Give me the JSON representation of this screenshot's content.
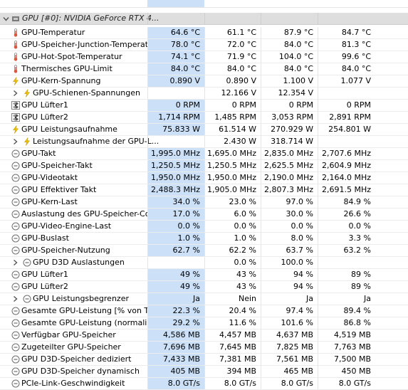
{
  "group": {
    "label": "GPU [#0]: NVIDIA GeForce RTX 4..."
  },
  "colors": {
    "selection": "#cce0f8",
    "thermo": "#d9573c",
    "bolt": "#f2c200",
    "clock_ring": "#6f6f6f"
  },
  "rows": [
    {
      "label": "GPU-Temperatur",
      "icon": "thermometer-icon",
      "indent": 0,
      "expandable": false,
      "values": [
        "64.6 °C",
        "61.1 °C",
        "87.9 °C",
        "84.7 °C"
      ]
    },
    {
      "label": "GPU-Speicher-Junction-Temperatur",
      "icon": "thermometer-icon",
      "indent": 0,
      "expandable": false,
      "values": [
        "78.0 °C",
        "72.0 °C",
        "84.0 °C",
        "81.3 °C"
      ]
    },
    {
      "label": "GPU-Hot-Spot-Temperatur",
      "icon": "thermometer-icon",
      "indent": 0,
      "expandable": false,
      "values": [
        "74.1 °C",
        "71.9 °C",
        "104.0 °C",
        "99.6 °C"
      ]
    },
    {
      "label": "Thermisches GPU-Limit",
      "icon": "thermometer-icon",
      "indent": 0,
      "expandable": false,
      "values": [
        "84.0 °C",
        "84.0 °C",
        "84.0 °C",
        "84.0 °C"
      ]
    },
    {
      "label": "GPU-Kern-Spannung",
      "icon": "lightning-icon",
      "indent": 0,
      "expandable": false,
      "values": [
        "0.890 V",
        "0.890 V",
        "1.100 V",
        "1.077 V"
      ]
    },
    {
      "label": "GPU-Schienen-Spannungen",
      "icon": "lightning-icon",
      "indent": 1,
      "expandable": true,
      "values": [
        "",
        "12.166 V",
        "12.354 V",
        ""
      ]
    },
    {
      "label": "GPU Lüfter1",
      "icon": "fan-icon",
      "indent": 0,
      "expandable": false,
      "values": [
        "0 RPM",
        "0 RPM",
        "0 RPM",
        "0 RPM"
      ]
    },
    {
      "label": "GPU Lüfter2",
      "icon": "fan-icon",
      "indent": 0,
      "expandable": false,
      "values": [
        "1,714 RPM",
        "1,485 RPM",
        "3,053 RPM",
        "2,891 RPM"
      ]
    },
    {
      "label": "GPU Leistungsaufnahme",
      "icon": "lightning-icon",
      "indent": 0,
      "expandable": false,
      "values": [
        "75.833 W",
        "61.514 W",
        "270.929 W",
        "254.801 W"
      ]
    },
    {
      "label": "Leistungsaufnahme der GPU-L...",
      "icon": "lightning-icon",
      "indent": 1,
      "expandable": true,
      "values": [
        "",
        "2.430 W",
        "318.714 W",
        ""
      ]
    },
    {
      "label": "GPU-Takt",
      "icon": "clock-icon",
      "indent": 0,
      "expandable": false,
      "values": [
        "1,995.0 MHz",
        "1,695.0 MHz",
        "2,835.0 MHz",
        "2,707.6 MHz"
      ]
    },
    {
      "label": "GPU-Speicher-Takt",
      "icon": "clock-icon",
      "indent": 0,
      "expandable": false,
      "values": [
        "1,250.5 MHz",
        "1,250.5 MHz",
        "2,625.5 MHz",
        "2,604.9 MHz"
      ]
    },
    {
      "label": "GPU-Videotakt",
      "icon": "clock-icon",
      "indent": 0,
      "expandable": false,
      "values": [
        "1,950.0 MHz",
        "1,950.0 MHz",
        "2,190.0 MHz",
        "2,164.0 MHz"
      ]
    },
    {
      "label": "GPU Effektiver Takt",
      "icon": "clock-icon",
      "indent": 0,
      "expandable": false,
      "values": [
        "2,488.3 MHz",
        "1,905.0 MHz",
        "2,807.3 MHz",
        "2,691.5 MHz"
      ]
    },
    {
      "label": "GPU-Kern-Last",
      "icon": "clock-icon",
      "indent": 0,
      "expandable": false,
      "values": [
        "34.0 %",
        "23.0 %",
        "97.0 %",
        "84.9 %"
      ]
    },
    {
      "label": "Auslastung des GPU-Speicher-Co...",
      "icon": "clock-icon",
      "indent": 0,
      "expandable": false,
      "values": [
        "17.0 %",
        "6.0 %",
        "30.0 %",
        "26.6 %"
      ]
    },
    {
      "label": "GPU-Video-Engine-Last",
      "icon": "clock-icon",
      "indent": 0,
      "expandable": false,
      "values": [
        "0.0 %",
        "0.0 %",
        "0.0 %",
        "0.0 %"
      ]
    },
    {
      "label": "GPU-Buslast",
      "icon": "clock-icon",
      "indent": 0,
      "expandable": false,
      "values": [
        "1.0 %",
        "1.0 %",
        "8.0 %",
        "3.3 %"
      ]
    },
    {
      "label": "GPU-Speicher-Nutzung",
      "icon": "clock-icon",
      "indent": 0,
      "expandable": false,
      "values": [
        "62.7 %",
        "62.2 %",
        "63.7 %",
        "63.2 %"
      ]
    },
    {
      "label": "GPU D3D Auslastungen",
      "icon": "clock-icon",
      "indent": 1,
      "expandable": true,
      "values": [
        "",
        "0.0 %",
        "100.0 %",
        ""
      ]
    },
    {
      "label": "GPU Lüfter1",
      "icon": "clock-icon",
      "indent": 0,
      "expandable": false,
      "values": [
        "49 %",
        "43 %",
        "94 %",
        "89 %"
      ]
    },
    {
      "label": "GPU Lüfter2",
      "icon": "clock-icon",
      "indent": 0,
      "expandable": false,
      "values": [
        "49 %",
        "43 %",
        "94 %",
        "89 %"
      ]
    },
    {
      "label": "GPU Leistungsbegrenzer",
      "icon": "clock-icon",
      "indent": 1,
      "expandable": true,
      "values": [
        "Ja",
        "Nein",
        "Ja",
        "Ja"
      ]
    },
    {
      "label": "Gesamte GPU-Leistung [% von T...",
      "icon": "clock-icon",
      "indent": 0,
      "expandable": false,
      "values": [
        "22.3 %",
        "20.4 %",
        "97.4 %",
        "89.4 %"
      ]
    },
    {
      "label": "Gesamte GPU-Leistung (normalisi...",
      "icon": "clock-icon",
      "indent": 0,
      "expandable": false,
      "values": [
        "29.2 %",
        "11.6 %",
        "101.6 %",
        "86.8 %"
      ]
    },
    {
      "label": "Verfügbar GPU-Speicher",
      "icon": "clock-icon",
      "indent": 0,
      "expandable": false,
      "values": [
        "4,586 MB",
        "4,457 MB",
        "4,637 MB",
        "4,519 MB"
      ]
    },
    {
      "label": "Zugeteilter GPU-Speicher",
      "icon": "clock-icon",
      "indent": 0,
      "expandable": false,
      "values": [
        "7,696 MB",
        "7,645 MB",
        "7,825 MB",
        "7,763 MB"
      ]
    },
    {
      "label": "GPU D3D-Speicher dediziert",
      "icon": "clock-icon",
      "indent": 0,
      "expandable": false,
      "values": [
        "7,433 MB",
        "7,381 MB",
        "7,561 MB",
        "7,500 MB"
      ]
    },
    {
      "label": "GPU D3D-Speicher dynamisch",
      "icon": "clock-icon",
      "indent": 0,
      "expandable": false,
      "values": [
        "405 MB",
        "394 MB",
        "465 MB",
        "450 MB"
      ]
    },
    {
      "label": "PCIe-Link-Geschwindigkeit",
      "icon": "clock-icon",
      "indent": 0,
      "expandable": false,
      "values": [
        "8.0 GT/s",
        "8.0 GT/s",
        "8.0 GT/s",
        "8.0 GT/s"
      ]
    }
  ]
}
